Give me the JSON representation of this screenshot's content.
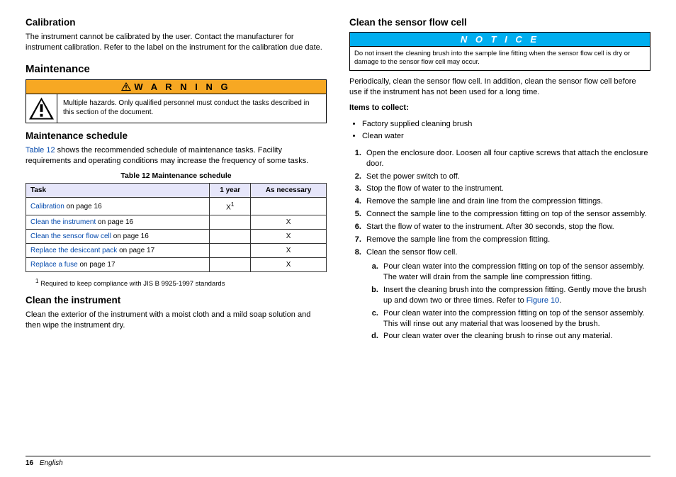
{
  "left": {
    "calibration": {
      "heading": "Calibration",
      "body": "The instrument cannot be calibrated by the user. Contact the manufacturer for instrument calibration. Refer to the label on the instrument for the calibration due date."
    },
    "maintenance": {
      "heading": "Maintenance",
      "warning_label": "W A R N I N G",
      "warning_text": "Multiple hazards. Only qualified personnel must conduct the tasks described in this section of the document."
    },
    "schedule": {
      "heading": "Maintenance schedule",
      "intro_link": "Table 12",
      "intro_rest": " shows the recommended schedule of maintenance tasks. Facility requirements and operating conditions may increase the frequency of some tasks.",
      "caption": "Table 12   Maintenance schedule",
      "headers": {
        "task": "Task",
        "y1": "1 year",
        "nec": "As necessary"
      },
      "rows": [
        {
          "link": "Calibration",
          "rest": " on page 16",
          "y1": "X",
          "sup": "1",
          "nec": ""
        },
        {
          "link": "Clean the instrument",
          "rest": " on page 16",
          "y1": "",
          "sup": "",
          "nec": "X"
        },
        {
          "link": "Clean the sensor flow cell",
          "rest": " on page 16",
          "y1": "",
          "sup": "",
          "nec": "X"
        },
        {
          "link": "Replace the desiccant pack",
          "rest": " on page 17",
          "y1": "",
          "sup": "",
          "nec": "X"
        },
        {
          "link": "Replace a fuse",
          "rest": " on page 17",
          "y1": "",
          "sup": "",
          "nec": "X"
        }
      ],
      "footnote_num": "1",
      "footnote_text": "   Required to keep compliance with JIS B 9925-1997 standards"
    },
    "clean_inst": {
      "heading": "Clean the instrument",
      "body": "Clean the exterior of the instrument with a moist cloth and a mild soap solution and then wipe the instrument dry."
    }
  },
  "right": {
    "heading": "Clean the sensor flow cell",
    "notice_label": "N O T I C E",
    "notice_text": "Do not insert the cleaning brush into the sample line fitting when the sensor flow cell is dry or damage to the sensor flow cell may occur.",
    "intro": "Periodically, clean the sensor flow cell. In addition, clean the sensor flow cell before use if the instrument has not been used for a long time.",
    "items_label": "Items to collect:",
    "items": [
      "Factory supplied cleaning brush",
      "Clean water"
    ],
    "steps": [
      "Open the enclosure door. Loosen all four captive screws that attach the enclosure door.",
      "Set the power switch to off.",
      "Stop the flow of water to the instrument.",
      "Remove the sample line and drain line from the compression fittings.",
      "Connect the sample line to the compression fitting on top of the sensor assembly.",
      "Start the flow of water to the instrument. After 30 seconds, stop the flow.",
      "Remove the sample line from the compression fitting.",
      "Clean the sensor flow cell."
    ],
    "sub": {
      "a": "Pour clean water into the compression fitting on top of the sensor assembly. The water will drain from the sample line compression fitting.",
      "b_pre": "Insert the cleaning brush into the compression fitting. Gently move the brush up and down two or three times. Refer to ",
      "b_link": "Figure 10",
      "b_post": ".",
      "c": "Pour clean water into the compression fitting on top of the sensor assembly. This will rinse out any material that was loosened by the brush.",
      "d": "Pour clean water over the cleaning brush to rinse out any material."
    }
  },
  "footer": {
    "page": "16",
    "lang": "English"
  }
}
